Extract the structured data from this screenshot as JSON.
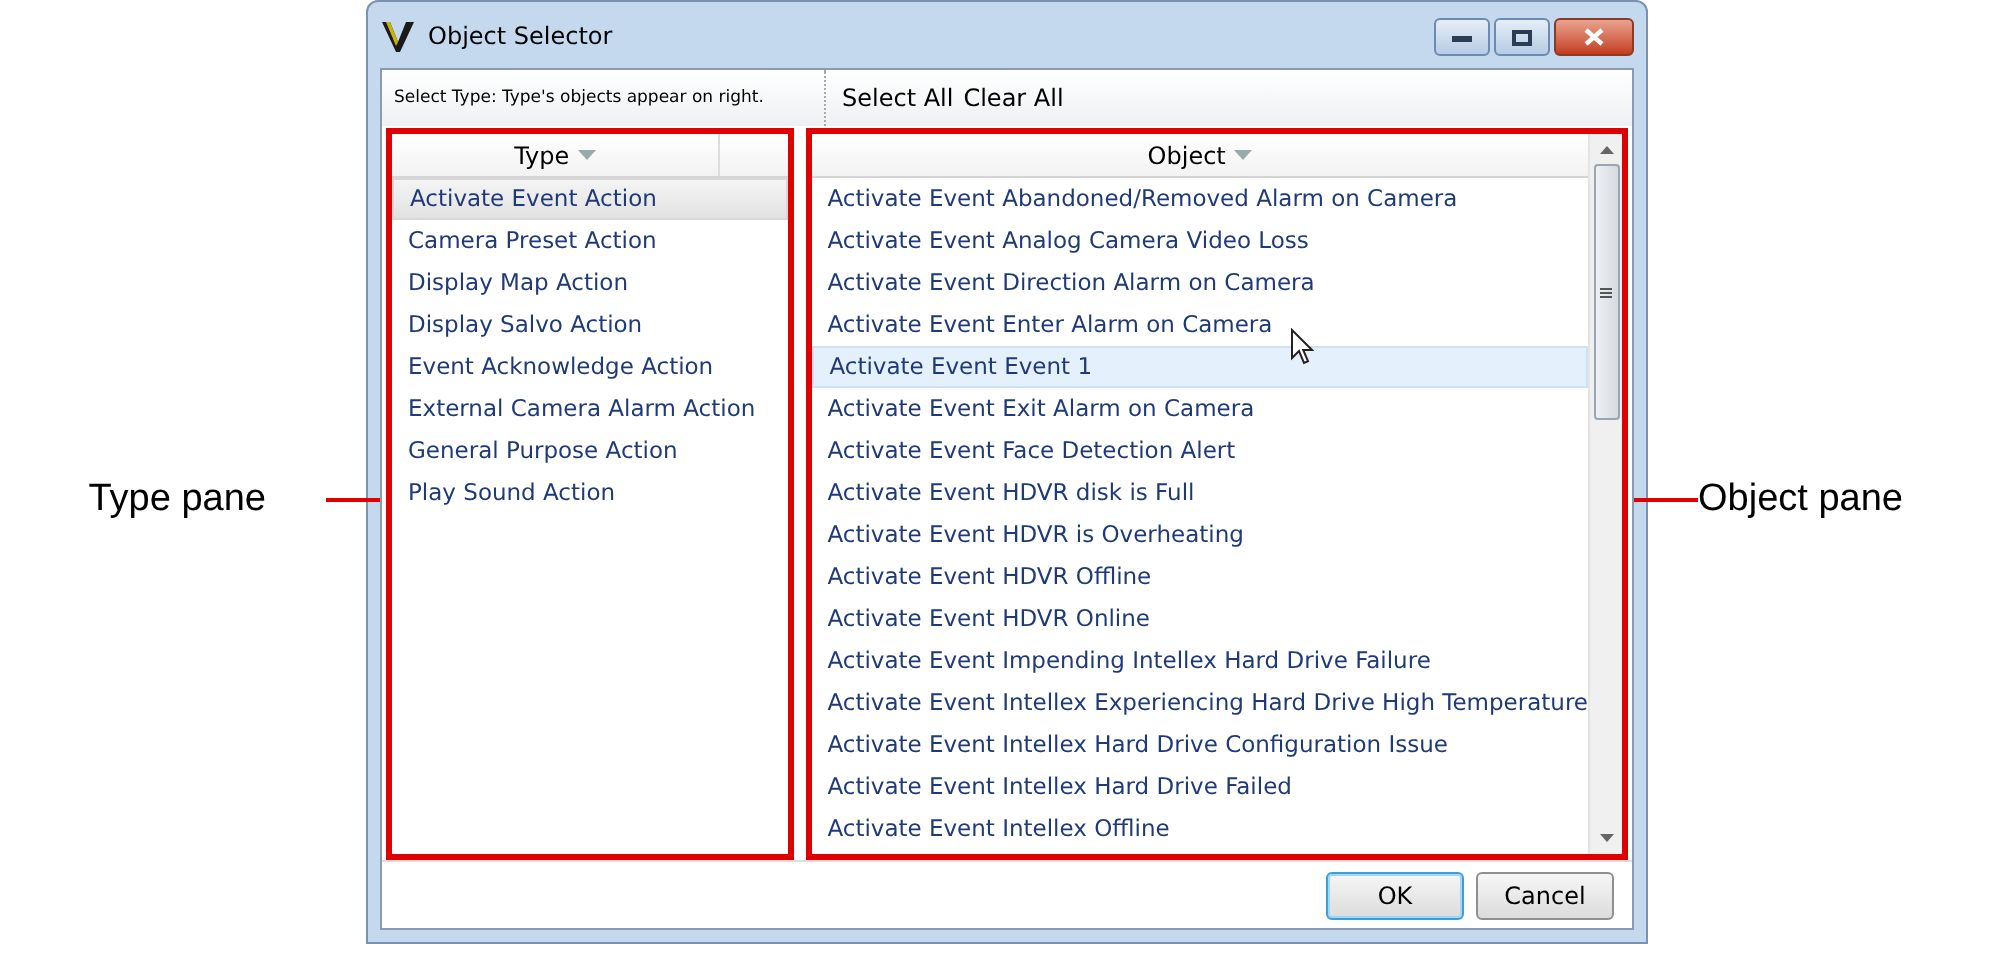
{
  "window": {
    "title": "Object Selector"
  },
  "hint": "Select Type: Type's objects appear on right.",
  "toolbar": [
    {
      "label": "Select All"
    },
    {
      "label": "Clear All"
    }
  ],
  "type_pane": {
    "header": "Type",
    "items": [
      {
        "label": "Activate Event Action",
        "selected": true
      },
      {
        "label": "Camera Preset Action",
        "selected": false
      },
      {
        "label": "Display Map Action",
        "selected": false
      },
      {
        "label": "Display Salvo Action",
        "selected": false
      },
      {
        "label": "Event Acknowledge Action",
        "selected": false
      },
      {
        "label": "External Camera Alarm Action",
        "selected": false
      },
      {
        "label": "General Purpose Action",
        "selected": false
      },
      {
        "label": "Play Sound Action",
        "selected": false
      }
    ]
  },
  "object_pane": {
    "header": "Object",
    "items": [
      {
        "label": "Activate Event Abandoned/Removed Alarm on Camera",
        "selected": false
      },
      {
        "label": "Activate Event Analog Camera Video Loss",
        "selected": false
      },
      {
        "label": "Activate Event Direction Alarm on Camera",
        "selected": false
      },
      {
        "label": "Activate Event Enter Alarm on Camera",
        "selected": false
      },
      {
        "label": "Activate Event Event 1",
        "selected": true
      },
      {
        "label": "Activate Event Exit Alarm on Camera",
        "selected": false
      },
      {
        "label": "Activate Event Face Detection Alert",
        "selected": false
      },
      {
        "label": "Activate Event HDVR disk is Full",
        "selected": false
      },
      {
        "label": "Activate Event HDVR is Overheating",
        "selected": false
      },
      {
        "label": "Activate Event HDVR Offline",
        "selected": false
      },
      {
        "label": "Activate Event HDVR Online",
        "selected": false
      },
      {
        "label": "Activate Event Impending Intellex Hard Drive Failure",
        "selected": false
      },
      {
        "label": "Activate Event Intellex Experiencing Hard Drive High Temperature",
        "selected": false
      },
      {
        "label": "Activate Event Intellex Hard Drive Configuration Issue",
        "selected": false
      },
      {
        "label": "Activate Event Intellex Hard Drive Failed",
        "selected": false
      },
      {
        "label": "Activate Event Intellex Offline",
        "selected": false
      }
    ]
  },
  "buttons": [
    {
      "label": "OK",
      "default": true
    },
    {
      "label": "Cancel",
      "default": false
    }
  ],
  "left_callout": {
    "label": "Type pane"
  },
  "right_callout": {
    "label": "Object pane"
  }
}
